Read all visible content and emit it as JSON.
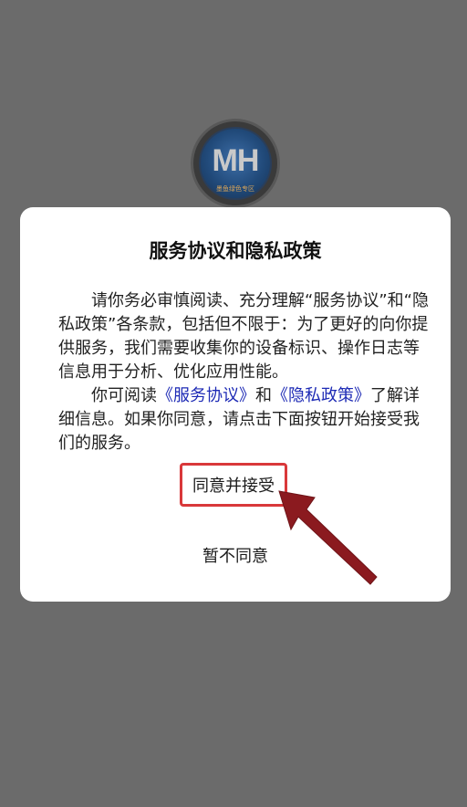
{
  "background": {
    "color": "#6b6b6b"
  },
  "logo": {
    "text": "MH",
    "subtext": "墨鱼绿色专区"
  },
  "dialog": {
    "title": "服务协议和隐私政策",
    "paragraph1": "请你务必审慎阅读、充分理解“服务协议”和“隐私政策”各条款，包括但不限于：为了更好的向你提供服务，我们需要收集你的设备标识、操作日志等信息用于分析、优化应用性能。",
    "paragraph2_prefix": "你可阅读",
    "link_service": "《服务协议》",
    "paragraph2_and": "和",
    "link_privacy": "《隐私政策》",
    "paragraph2_suffix": "了解详细信息。如果你同意，请点击下面按钮开始接受我们的服务。",
    "agree_label": "同意并接受",
    "disagree_label": "暂不同意"
  },
  "colors": {
    "link": "#1d2ab5",
    "highlight_border": "#d9383a",
    "arrow": "#8b1a1f"
  },
  "icons": {
    "annotation_arrow": "arrow-annotation-icon"
  }
}
